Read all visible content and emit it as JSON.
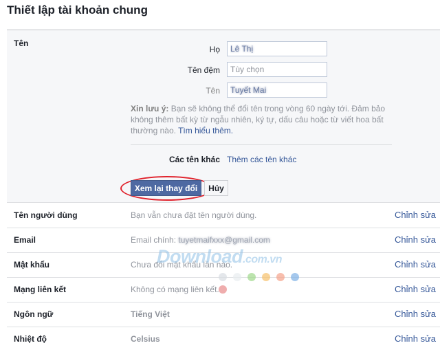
{
  "page_title": "Thiết lập tài khoản chung",
  "name_section": {
    "label": "Tên",
    "fields": [
      {
        "label": "Họ",
        "value": "Lê Thị",
        "placeholder": ""
      },
      {
        "label": "Tên đệm",
        "value": "",
        "placeholder": "Tùy chọn"
      },
      {
        "label": "Tên",
        "value": "Tuyết Mai",
        "placeholder": ""
      }
    ],
    "note_prefix": "Xin lưu ý:",
    "note_text": " Bạn sẽ không thể đổi tên trong vòng 60 ngày tới. Đảm bảo không thêm bất kỳ từ ngẫu nhiên, ký tự, dấu câu hoặc từ viết hoa bất thường nào. ",
    "note_link": "Tìm hiểu thêm.",
    "other_names_label": "Các tên khác",
    "other_names_link": "Thêm các tên khác",
    "review_button": "Xem lại thay đổi",
    "cancel_button": "Hủy"
  },
  "settings": [
    {
      "label": "Tên người dùng",
      "value": "Bạn vẫn chưa đặt tên người dùng.",
      "edit": "Chỉnh sửa"
    },
    {
      "label": "Email",
      "value_prefix": "Email chính: ",
      "value": "tuyetmaifxxx@gmail.com",
      "edit": "Chỉnh sửa"
    },
    {
      "label": "Mật khẩu",
      "value": "Chưa đổi mật khẩu lần nào.",
      "edit": "Chỉnh sửa"
    },
    {
      "label": "Mạng liên kết",
      "value": "Không có mạng liên kết.",
      "edit": "Chỉnh sửa"
    },
    {
      "label": "Ngôn ngữ",
      "value": "Tiếng Việt",
      "edit": "Chỉnh sửa"
    },
    {
      "label": "Nhiệt độ",
      "value": "Celsius",
      "edit": "Chỉnh sửa"
    }
  ],
  "watermark": {
    "main": "Download",
    "suffix": ".com.vn",
    "dot_colors": [
      "#d9dde2",
      "#e8ecef",
      "#9fd98b",
      "#f7c16b",
      "#f5a28a",
      "#7fb0e6",
      "#e88a8a"
    ]
  },
  "colors": {
    "link": "#365899",
    "primary_button": "#4e69a2",
    "highlight": "#e0222c",
    "panel_bg": "#f6f7f9"
  }
}
